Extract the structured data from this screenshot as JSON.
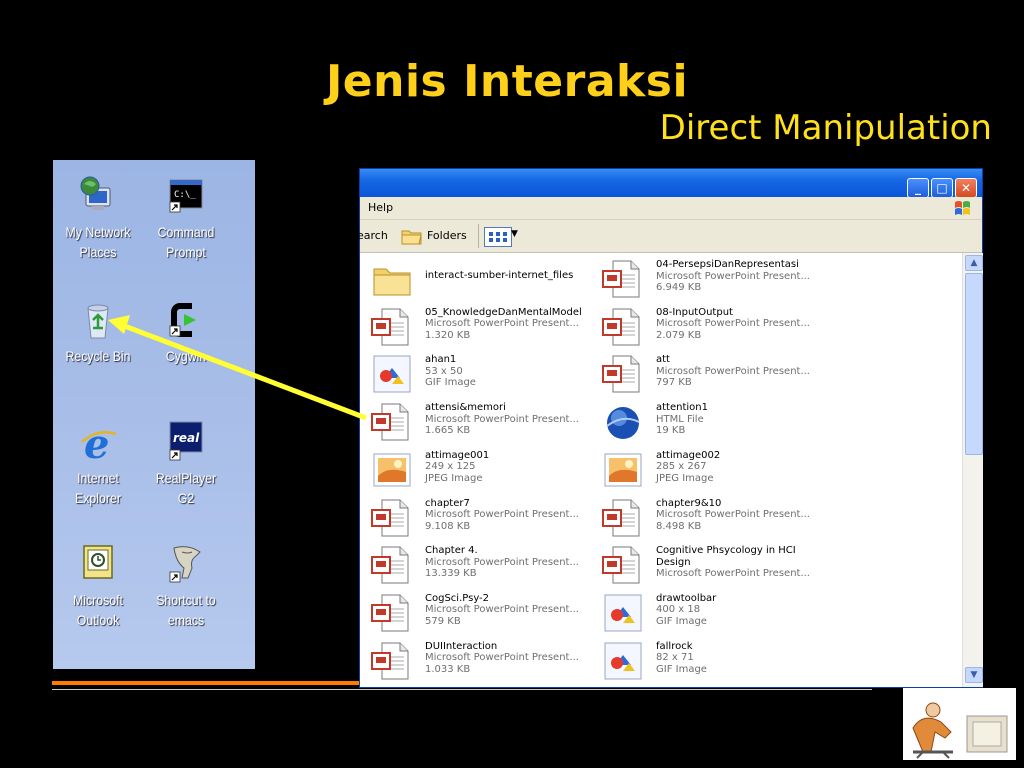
{
  "slide": {
    "title": "Jenis Interaksi",
    "subtitle": "Direct Manipulation"
  },
  "desktop": {
    "icons": [
      {
        "label": "My Network Places",
        "icon": "network-places-icon"
      },
      {
        "label": "Command Prompt",
        "icon": "command-prompt-icon"
      },
      {
        "label": "Recycle Bin",
        "icon": "recycle-bin-icon"
      },
      {
        "label": "Cygwin",
        "icon": "cygwin-icon"
      },
      {
        "label": "Internet Explorer",
        "icon": "internet-explorer-icon"
      },
      {
        "label": "RealPlayer G2",
        "icon": "realplayer-icon"
      },
      {
        "label": "Microsoft Outlook",
        "icon": "outlook-icon"
      },
      {
        "label": "Shortcut to emacs",
        "icon": "emacs-icon"
      }
    ],
    "cmd_glyph": "C:\\_",
    "real_glyph": "real"
  },
  "window": {
    "menu": {
      "help": "Help"
    },
    "toolbar": {
      "search": "earch",
      "folders": "Folders"
    },
    "buttons": {
      "minimize": "_",
      "maximize": "□",
      "close": "✕"
    },
    "scroll": {
      "up": "▲",
      "down": "▼"
    },
    "files": [
      {
        "name": "interact-sumber-internet_files",
        "line1": "",
        "line2": "",
        "type": "folder"
      },
      {
        "name": "04-PersepsiDanRepresentasi",
        "line1": "Microsoft PowerPoint Present...",
        "line2": "6.949 KB",
        "type": "ppt"
      },
      {
        "name": "05_KnowledgeDanMentalModel",
        "line1": "Microsoft PowerPoint Present...",
        "line2": "1.320 KB",
        "type": "ppt"
      },
      {
        "name": "08-InputOutput",
        "line1": "Microsoft PowerPoint Present...",
        "line2": "2.079 KB",
        "type": "ppt"
      },
      {
        "name": "ahan1",
        "line1": "53 x 50",
        "line2": "GIF Image",
        "type": "gif"
      },
      {
        "name": "att",
        "line1": "Microsoft PowerPoint Present...",
        "line2": "797 KB",
        "type": "ppt"
      },
      {
        "name": "attensi&memori",
        "line1": "Microsoft PowerPoint Present...",
        "line2": "1.665 KB",
        "type": "ppt"
      },
      {
        "name": "attention1",
        "line1": "HTML File",
        "line2": "19 KB",
        "type": "html"
      },
      {
        "name": "attimage001",
        "line1": "249 x 125",
        "line2": "JPEG Image",
        "type": "jpeg"
      },
      {
        "name": "attimage002",
        "line1": "285 x 267",
        "line2": "JPEG Image",
        "type": "jpeg"
      },
      {
        "name": "chapter7",
        "line1": "Microsoft PowerPoint Present...",
        "line2": "9.108 KB",
        "type": "ppt"
      },
      {
        "name": "chapter9&10",
        "line1": "Microsoft PowerPoint Present...",
        "line2": "8.498 KB",
        "type": "ppt"
      },
      {
        "name": "Chapter 4.",
        "line1": "Microsoft PowerPoint Present...",
        "line2": "13.339 KB",
        "type": "ppt"
      },
      {
        "name": "Cognitive Phsycology in HCI",
        "line1": "Design",
        "line2": "Microsoft PowerPoint Present...",
        "type": "ppt"
      },
      {
        "name": "CogSci.Psy-2",
        "line1": "Microsoft PowerPoint Present...",
        "line2": "579 KB",
        "type": "ppt"
      },
      {
        "name": "drawtoolbar",
        "line1": "400 x 18",
        "line2": "GIF Image",
        "type": "gif"
      },
      {
        "name": "DUIInteraction",
        "line1": "Microsoft PowerPoint Present...",
        "line2": "1.033 KB",
        "type": "ppt"
      },
      {
        "name": "fallrock",
        "line1": "82 x 71",
        "line2": "GIF Image",
        "type": "gif"
      }
    ]
  },
  "colors": {
    "title": "#ffd01a",
    "arrow": "#ffff33",
    "divider": "#ff7a00",
    "xp_blue": "#0b54d6"
  }
}
